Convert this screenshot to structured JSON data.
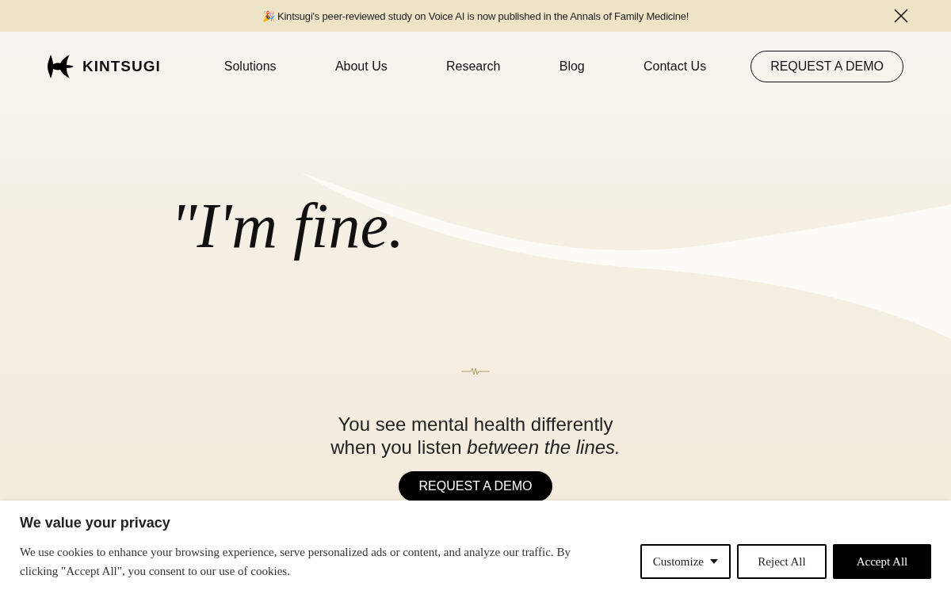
{
  "announcement": {
    "emoji": "🎉",
    "text": "Kintsugi's peer-reviewed study on Voice AI is now published in the Annals of Family Medicine!"
  },
  "nav": {
    "logo": "KINTSUGI",
    "links": [
      "Solutions",
      "About Us",
      "Research",
      "Blog",
      "Contact Us"
    ],
    "cta": "REQUEST A DEMO"
  },
  "hero": {
    "quote": "\"I'm fine.",
    "tagline_1": "You see mental health differently",
    "tagline_2": "when you listen *between the lines.*",
    "cta": "REQUEST A DEMO"
  },
  "cookie_banner": {
    "title": "We value your privacy",
    "text": "We use cookies to enhance your browsing experience, serve personalized ads or content, and analyze our traffic. By clicking \"Accept All\", you consent to our use of cookies.",
    "buttons": [
      {
        "label": "Customize",
        "kind": "dropdown"
      },
      {
        "label": "Reject All",
        "kind": "outline"
      },
      {
        "label": "Accept All",
        "kind": "primary"
      }
    ]
  }
}
